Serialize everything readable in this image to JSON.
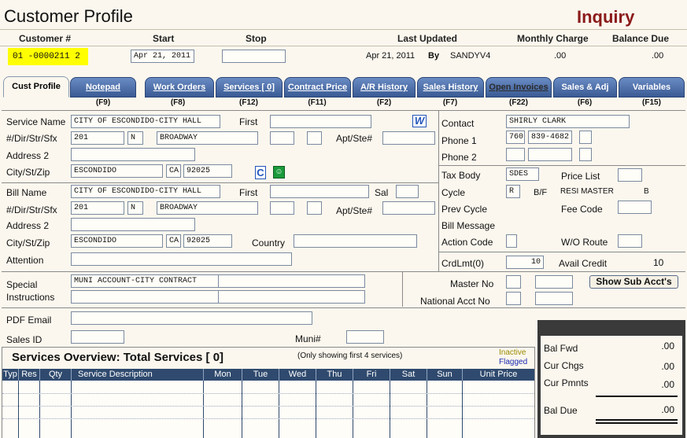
{
  "window": {
    "title": "Customer Profile",
    "mode": "Inquiry"
  },
  "header": {
    "customer_no_label": "Customer #",
    "start_label": "Start",
    "stop_label": "Stop",
    "last_updated_label": "Last Updated",
    "monthly_charge_label": "Monthly Charge",
    "balance_due_label": "Balance Due",
    "customer_no": "01 -0000211 2",
    "start": "Apr 21, 2011",
    "stop": "",
    "last_updated": "Apr 21, 2011",
    "by_label": "By",
    "by_user": "SANDYV4",
    "monthly_charge": ".00",
    "balance_due": ".00"
  },
  "tabs": [
    {
      "label": "Cust Profile",
      "key": ""
    },
    {
      "label": "Notepad",
      "key": "(F9)"
    },
    {
      "label": "Work Orders",
      "key": "(F8)"
    },
    {
      "label": "Services [    0]",
      "key": "(F12)"
    },
    {
      "label": "Contract Price",
      "key": "(F11)"
    },
    {
      "label": "A/R History",
      "key": "(F2)"
    },
    {
      "label": "Sales History",
      "key": "(F7)"
    },
    {
      "label": "Open Invoices",
      "key": "(F22)"
    },
    {
      "label": "Sales & Adj",
      "key": "(F6)"
    },
    {
      "label": "Variables",
      "key": "(F15)"
    }
  ],
  "service": {
    "name_label": "Service Name",
    "name": "CITY OF ESCONDIDO-CITY HALL",
    "first_label": "First",
    "first": "",
    "dir_label": "#/Dir/Str/Sfx",
    "number": "201",
    "dir": "N",
    "street": "BROADWAY",
    "sfx1": "",
    "sfx2": "",
    "apt_label": "Apt/Ste#",
    "apt": "",
    "address2_label": "Address 2",
    "address2": "",
    "csz_label": "City/St/Zip",
    "city": "ESCONDIDO",
    "state": "CA",
    "zip": "92025"
  },
  "contact": {
    "contact_label": "Contact",
    "contact": "SHIRLY CLARK",
    "phone1_label": "Phone 1",
    "phone1_area": "760",
    "phone1_num": "839-4682",
    "phone2_label": "Phone 2"
  },
  "billing_info": {
    "tax_body_label": "Tax Body",
    "tax_body": "SDES",
    "price_list_label": "Price List",
    "cycle_label": "Cycle",
    "cycle": "R",
    "cycle_bf": "B/F",
    "resi_master": "RESI MASTER",
    "resi_code": "B",
    "prev_cycle_label": "Prev Cycle",
    "fee_code_label": "Fee Code",
    "bill_message_label": "Bill Message",
    "action_code_label": "Action Code",
    "wo_route_label": "W/O Route",
    "crdlmt_label": "CrdLmt(0)",
    "crdlmt": "10",
    "avail_credit_label": "Avail Credit",
    "avail_credit": "10"
  },
  "bill": {
    "name_label": "Bill Name",
    "name": "CITY OF ESCONDIDO-CITY HALL",
    "first_label": "First",
    "sal_label": "Sal",
    "dir_label": "#/Dir/Str/Sfx",
    "number": "201",
    "dir": "N",
    "street": "BROADWAY",
    "apt_label": "Apt/Ste#",
    "address2_label": "Address 2",
    "csz_label": "City/St/Zip",
    "city": "ESCONDIDO",
    "state": "CA",
    "zip": "92025",
    "country_label": "Country",
    "attention_label": "Attention"
  },
  "special": {
    "label1": "Special",
    "label2": "Instructions",
    "line1": "MUNI ACCOUNT-CITY CONTRACT",
    "master_no_label": "Master No",
    "national_acct_label": "National Acct No",
    "show_sub_button": "Show Sub Acct's"
  },
  "misc": {
    "pdf_email_label": "PDF Email",
    "sales_id_label": "Sales ID",
    "muni_label": "Muni#"
  },
  "services_overview": {
    "title": "Services Overview: Total Services [    0]",
    "note": "(Only showing first 4 services)",
    "inactive": "Inactive",
    "flagged": "Flagged",
    "columns": [
      "Typ",
      "Res",
      "Qty",
      "Service Description",
      "Mon",
      "Tue",
      "Wed",
      "Thu",
      "Fri",
      "Sat",
      "Sun",
      "Unit Price"
    ]
  },
  "balances": {
    "bal_fwd_label": "Bal Fwd",
    "bal_fwd": ".00",
    "cur_chgs_label": "Cur Chgs",
    "cur_chgs": ".00",
    "cur_pmnts_label": "Cur Pmnts",
    "cur_pmnts": ".00",
    "bal_due_label": "Bal Due",
    "bal_due": ".00"
  },
  "colors": {
    "tab_blue": "#3a5a94",
    "inquiry_red": "#8b1a1a",
    "highlight_yellow": "#ffff00",
    "grid_header": "#2f4a6e"
  }
}
